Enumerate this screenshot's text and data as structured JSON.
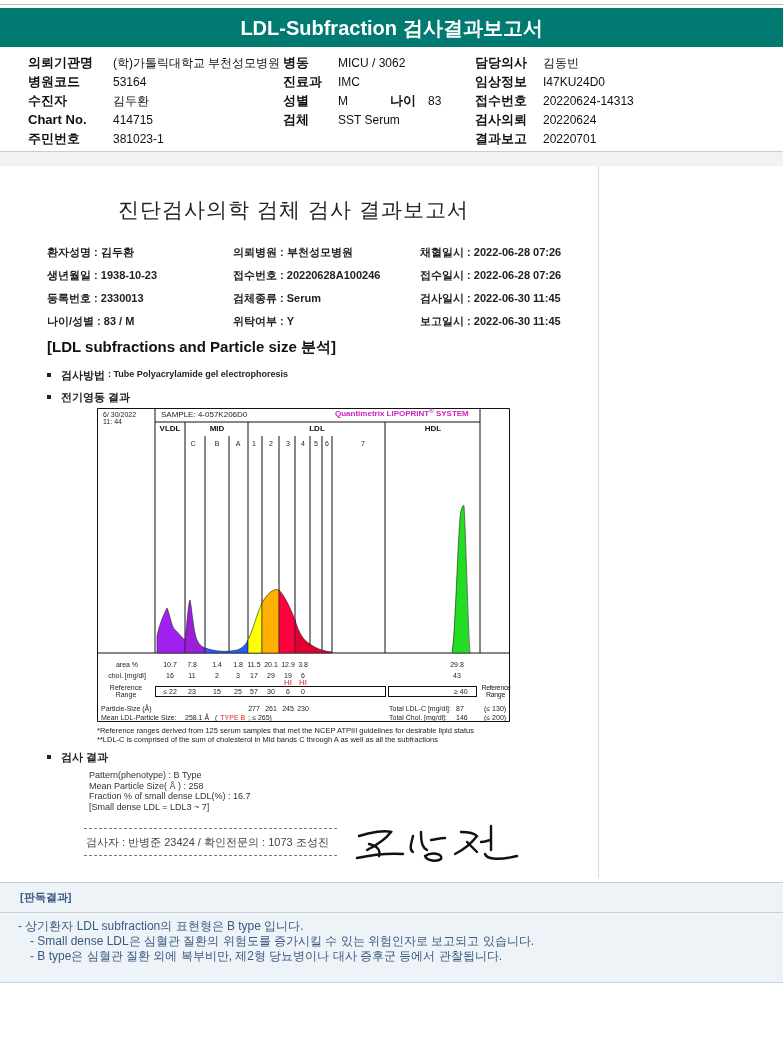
{
  "title": "LDL-Subfraction 검사결과보고서",
  "info_rows": [
    {
      "left": {
        "label": "의뢰기관명",
        "value": "(학)가톨릭대학교 부천성모병원"
      },
      "middle": [
        {
          "label": "병동",
          "value": "MICU / 3062"
        }
      ],
      "right": {
        "label": "담당의사",
        "value": "김동빈"
      }
    },
    {
      "left": {
        "label": "병원코드",
        "value": "53164"
      },
      "middle": [
        {
          "label": "진료과",
          "value": "IMC"
        }
      ],
      "right": {
        "label": "임상정보",
        "value": "I47KU24D0"
      }
    },
    {
      "left": {
        "label": "수진자",
        "value": "김두환"
      },
      "middle": [
        {
          "label": "성별",
          "value": "M"
        },
        {
          "label": "나이",
          "value": "83"
        }
      ],
      "right": {
        "label": "접수번호",
        "value": "20220624-14313"
      }
    },
    {
      "left": {
        "label": "Chart No.",
        "value": "414715"
      },
      "middle": [
        {
          "label": "검체",
          "value": "SST Serum"
        }
      ],
      "right": {
        "label": "검사의뢰",
        "value": "20220624"
      }
    },
    {
      "left": {
        "label": "주민번호",
        "value": "381023-1"
      },
      "right": {
        "label": "결과보고",
        "value": "20220701"
      }
    }
  ],
  "report": {
    "title": "진단검사의학 검체 검사 결과보고서",
    "patient_rows": [
      [
        "환자성명 : 김두환",
        "의뢰병원 : 부천성모병원",
        "채혈일시 : 2022-06-28 07:26"
      ],
      [
        "생년월일 : 1938-10-23",
        "접수번호 : 20220628A100246",
        "접수일시 : 2022-06-28 07:26"
      ],
      [
        "등록번호 : 2330013",
        "검체종류 : Serum",
        "검사일시 : 2022-06-30 11:45"
      ],
      [
        "나이/성별 : 83 / M",
        "위탁여부 : Y",
        "보고일시 : 2022-06-30 11:45"
      ]
    ],
    "section_title": "[LDL subfractions and Particle size 분석]",
    "method": {
      "label": "검사방법",
      "value": ": Tube Polyacrylamide gel electrophoresis"
    },
    "electrophoresis_heading": "전기영동 결과",
    "lipoprint": {
      "date": "6/ 30/2022",
      "time": "11: 44",
      "sample": "SAMPLE:   4-057K206D0",
      "system": "Quantimetrix LIPOPRINT$^{®}$ SYSTEM",
      "bands": [
        {
          "label": "VLDL"
        },
        {
          "label": "MID",
          "subs": [
            "C",
            "B",
            "A"
          ]
        },
        {
          "label": "LDL",
          "subs": [
            "1",
            "2",
            "3",
            "4",
            "5",
            "6",
            "7"
          ]
        },
        {
          "label": "HDL"
        }
      ],
      "area_label": "area %",
      "area": [
        "10.7",
        "7.8",
        "1.4",
        "1.8",
        "11.5",
        "20.1",
        "12.9",
        "3.8"
      ],
      "area_hdl": "29.8",
      "chol_label": "chol. [mg/dl]",
      "chol": [
        {
          "value": "16"
        },
        {
          "value": "11"
        },
        {
          "value": "2"
        },
        {
          "value": "3"
        },
        {
          "value": "17"
        },
        {
          "value": "29"
        },
        {
          "value": "19",
          "flag": "HI"
        },
        {
          "value": "6",
          "flag": "HI"
        }
      ],
      "chol_hdl": "43",
      "reference_label_left": "Reference Range",
      "reference": [
        "≤ 22",
        "23",
        "15",
        "25",
        "57",
        "30",
        "6",
        "0"
      ],
      "reference_hdl": "≥ 40",
      "reference_label_right": "Reference Range",
      "particle_label": "Particle-Size (Å)",
      "particle": [
        "277",
        "261",
        "245",
        "230"
      ],
      "total_ldl_label": "Total LDL-C [mg/dl]:",
      "total_ldl": "87",
      "total_ldl_limit": "(≤ 130)",
      "mean_label": "Mean LDL-Particle Size:",
      "mean_value": "258.1 Å",
      "type_note": [
        {
          "text": "(",
          "flagged": false
        },
        {
          "text": "TYPE B",
          "flagged": true
        },
        {
          "text": "; ≤ 265)",
          "flagged": false
        }
      ],
      "total_chol_label": "Total Chol. [mg/dl]:",
      "total_chol": "146",
      "total_chol_limit": "(≤ 200)"
    },
    "footnotes": [
      "*Reference ranges derived from 125 serum samples that met the NCEP ATPIII guidelines for desirable lipid status",
      "**LDL-C is comprised of the sum of cholesterol in Mid bands C through A as well as all the subfractions"
    ],
    "result_heading": "검사 결과",
    "result_lines": [
      "Pattern(phenotype) : B Type",
      "Mean Particle Size( Å ) : 258",
      "Fraction % of small dense LDL(%) : 16.7",
      "[Small dense LDL = LDL3 ~ 7]"
    ],
    "signature_line": "검사자 : 반병준  23424  /  확인전문의 : 1073  조성진"
  },
  "interpretation": {
    "heading": "[판독결과]",
    "lines": [
      {
        "text": "- 상기환자 LDL subfraction의 표현형은 B type 입니다.",
        "children": [
          {
            "text": "-  Small dense LDL은 심혈관 질환의 위험도를 증가시킬 수 있는 위험인자로 보고되고 있습니다."
          },
          {
            "text": "-  B type은 심혈관 질환 외에 복부비만, 제2형 당뇨병이나 대사 증후군 등에서 관찰됩니다."
          }
        ]
      }
    ]
  }
}
